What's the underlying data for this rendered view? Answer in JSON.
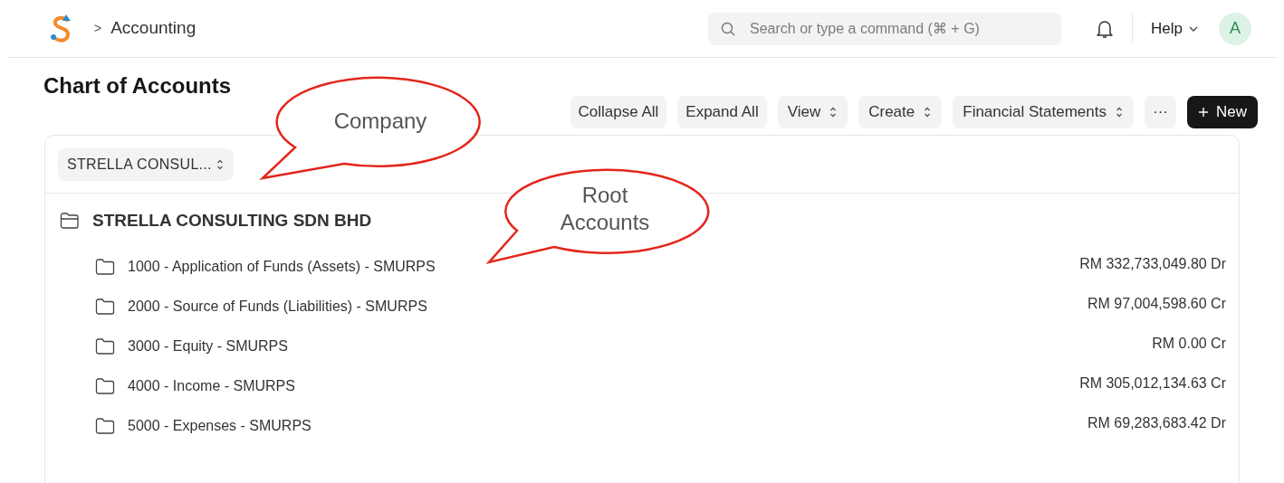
{
  "breadcrumb": {
    "separator": ">",
    "label": "Accounting"
  },
  "search": {
    "placeholder": "Search or type a command (⌘ + G)"
  },
  "help": {
    "label": "Help"
  },
  "avatar": {
    "initial": "A"
  },
  "page_title": "Chart of Accounts",
  "toolbar": [
    {
      "label": "Collapse All",
      "kind": "plain"
    },
    {
      "label": "Expand All",
      "kind": "plain"
    },
    {
      "label": "View",
      "kind": "select"
    },
    {
      "label": "Create",
      "kind": "select"
    },
    {
      "label": "Financial Statements",
      "kind": "select"
    },
    {
      "label": "···",
      "kind": "plain"
    },
    {
      "label": "New",
      "kind": "primary"
    }
  ],
  "company_filter": {
    "value": "STRELLA CONSUL..."
  },
  "tree": {
    "label": "STRELLA CONSULTING SDN BHD",
    "expanded": true,
    "children": [
      {
        "label": "1000 - Application of Funds (Assets) - SMURPS",
        "balance": "RM 332,733,049.80 Dr"
      },
      {
        "label": "2000 - Source of Funds (Liabilities) - SMURPS",
        "balance": "RM 97,004,598.60 Cr"
      },
      {
        "label": "3000 - Equity - SMURPS",
        "balance": "RM 0.00 Cr"
      },
      {
        "label": "4000 - Income - SMURPS",
        "balance": "RM 305,012,134.63 Cr"
      },
      {
        "label": "5000 - Expenses - SMURPS",
        "balance": "RM 69,283,683.42 Dr"
      }
    ]
  },
  "annotations": [
    {
      "text": "Company"
    },
    {
      "text": "Root Accounts"
    }
  ]
}
